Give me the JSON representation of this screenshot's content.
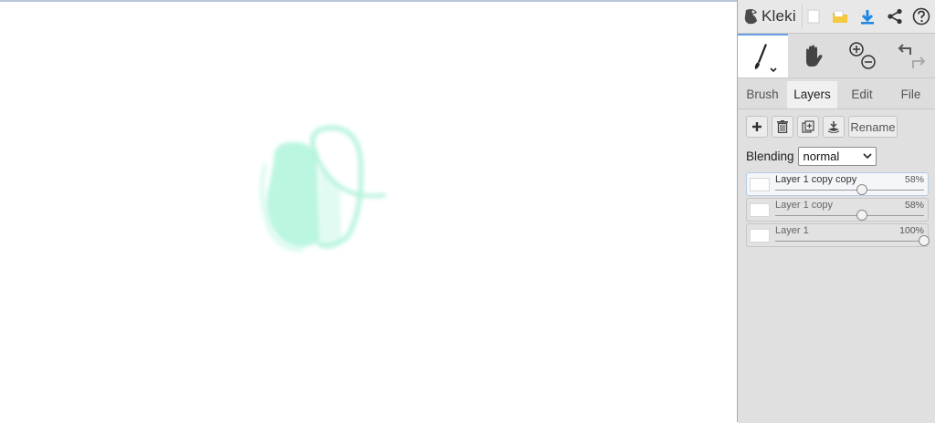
{
  "app": {
    "logo_text": "Kleki"
  },
  "toolbar": {
    "icons": [
      "new-image-icon",
      "open-folder-icon",
      "download-icon",
      "share-icon",
      "help-icon"
    ]
  },
  "tools": {
    "icons": [
      "brush-icon",
      "hand-icon",
      "zoom-icon",
      "undo-redo-icon"
    ]
  },
  "tabs": [
    {
      "label": "Brush",
      "active": false
    },
    {
      "label": "Layers",
      "active": true
    },
    {
      "label": "Edit",
      "active": false
    },
    {
      "label": "File",
      "active": false
    }
  ],
  "layer_actions": {
    "rename_label": "Rename"
  },
  "blending": {
    "label": "Blending",
    "value": "normal"
  },
  "layers": [
    {
      "name": "Layer 1 copy copy",
      "opacity_label": "58%",
      "opacity": 58,
      "selected": true
    },
    {
      "name": "Layer 1 copy",
      "opacity_label": "58%",
      "opacity": 58,
      "selected": false
    },
    {
      "name": "Layer 1",
      "opacity_label": "100%",
      "opacity": 100,
      "selected": false
    }
  ],
  "colors": {
    "accent": "#6aa0e8",
    "stroke": "#b7f5df",
    "download": "#1e88e5",
    "folder": "#f2c12e"
  }
}
